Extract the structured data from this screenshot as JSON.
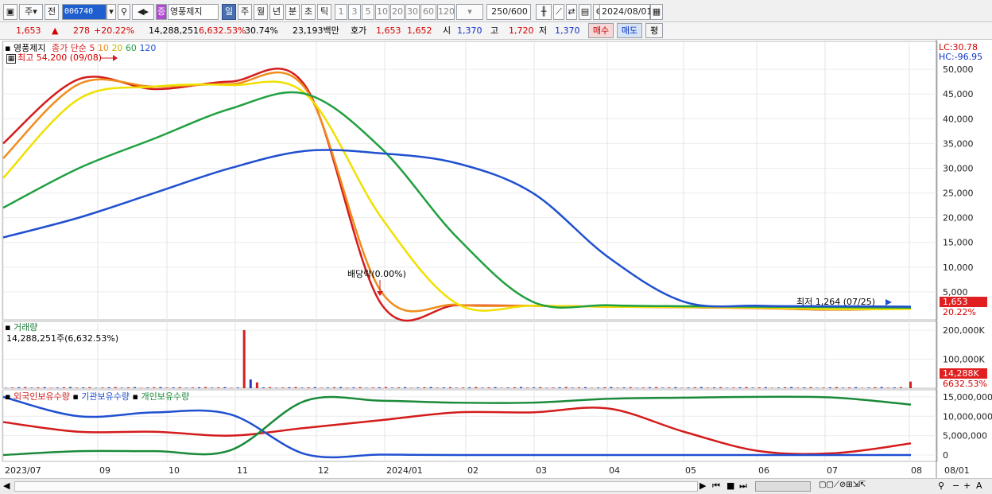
{
  "toolbar": {
    "period_type": "주",
    "prev_label": "전",
    "stock_code": "006740",
    "stock_name": "영풍제지",
    "stock_badge": "증",
    "period_tabs": [
      "일",
      "주",
      "월",
      "년",
      "분",
      "초",
      "틱"
    ],
    "minute_options": [
      "1",
      "3",
      "5",
      "10",
      "20",
      "30",
      "60",
      "120"
    ],
    "count": "250",
    "count_total": "/600",
    "date": "2024/08/01"
  },
  "quote": {
    "price": "1,653",
    "arrow": "▲",
    "change": "278",
    "change_pct": "+20.22%",
    "volume": "14,288,251",
    "volume_pct": "6,632.53%",
    "turnover": "30.74%",
    "amount": "23,193백만",
    "hoga_label": "호가",
    "ask": "1,653",
    "bid": "1,652",
    "open_label": "시",
    "open": "1,370",
    "high_label": "고",
    "high": "1,720",
    "low_label": "저",
    "low": "1,370",
    "buy_label": "매수",
    "sell_label": "매도",
    "eval_label": "평"
  },
  "price_panel": {
    "stock_label": "영풍제지",
    "ma_label": "종가 단순",
    "ma_periods": [
      "5",
      "10",
      "20",
      "60",
      "120"
    ],
    "ma_colors": [
      "#d41c1c",
      "#f08c1c",
      "#f0e000",
      "#20a040",
      "#2050d0"
    ],
    "high_marker": "최고 54,200 (09/08)",
    "low_marker": "최저 1,264 (07/25)",
    "dividend_marker": "배당락(0.00%)",
    "lc_label": "LC:30.78",
    "hc_label": "HC:-96.95",
    "last_price_label": "1,653",
    "last_change_label": "20.22%",
    "y_ticks": [
      "50,000",
      "45,000",
      "40,000",
      "35,000",
      "30,000",
      "25,000",
      "20,000",
      "15,000",
      "10,000",
      "5,000"
    ]
  },
  "volume_panel": {
    "title": "거래량",
    "value_label": "14,288,251주(6,632.53%)",
    "y_ticks": [
      "200,000K",
      "100,000K"
    ],
    "last_label": "14,288K",
    "last_pct": "6632.53%"
  },
  "holding_panel": {
    "series": [
      "외국인보유수량",
      "기관보유수량",
      "개인보유수량"
    ],
    "y_ticks": [
      "15,000,000",
      "10,000,000",
      "5,000,000",
      "0"
    ]
  },
  "x_axis": {
    "labels": [
      "2023/07",
      "09",
      "10",
      "11",
      "12",
      "2024/01",
      "02",
      "03",
      "04",
      "05",
      "06",
      "07",
      "08",
      "08/01"
    ]
  },
  "chart_data": [
    {
      "type": "line",
      "title": "",
      "ylim": [
        0,
        54200
      ],
      "series": [
        {
          "name": "5",
          "values": [
            35000,
            48000,
            46000,
            47500,
            46500,
            2500,
            2300,
            2200,
            2000,
            1900,
            1700,
            1400,
            1650
          ]
        },
        {
          "name": "10",
          "values": [
            32000,
            47000,
            46500,
            47000,
            46000,
            5000,
            2400,
            2200,
            2000,
            1900,
            1750,
            1450,
            1600
          ]
        },
        {
          "name": "20",
          "values": [
            28000,
            44000,
            46500,
            46800,
            45000,
            20000,
            2600,
            2200,
            2000,
            1950,
            1800,
            1500,
            1550
          ]
        },
        {
          "name": "60",
          "values": [
            22000,
            30000,
            36000,
            42000,
            45000,
            34000,
            16000,
            3000,
            2300,
            2100,
            2000,
            1900,
            1800
          ]
        },
        {
          "name": "120",
          "values": [
            16000,
            20000,
            25000,
            30000,
            33500,
            33000,
            31000,
            25000,
            12000,
            3000,
            2200,
            2100,
            2000
          ]
        }
      ],
      "annotations": [
        "최고 54,200 (09/08)",
        "최저 1,264 (07/25)"
      ]
    },
    {
      "type": "bar",
      "title": "거래량",
      "ylim": [
        0,
        230000
      ],
      "value_unit": "K",
      "peak": 200000,
      "last": 14288
    },
    {
      "type": "line",
      "title": "",
      "ylim": [
        0,
        15000000
      ],
      "series": [
        {
          "name": "외국인보유수량",
          "values": [
            8500000,
            6000000,
            6000000,
            5000000,
            7000000,
            9000000,
            11000000,
            11000000,
            12000000,
            6000000,
            1000000,
            500000,
            3000000
          ]
        },
        {
          "name": "기관보유수량",
          "values": [
            15000000,
            10000000,
            11000000,
            10500000,
            200000,
            100000,
            0,
            0,
            0,
            0,
            0,
            0,
            0
          ]
        },
        {
          "name": "개인보유수량",
          "values": [
            0,
            1000000,
            1000000,
            1200000,
            14000000,
            14000000,
            13500000,
            13500000,
            14500000,
            14800000,
            15000000,
            14800000,
            13000000
          ]
        }
      ]
    }
  ]
}
